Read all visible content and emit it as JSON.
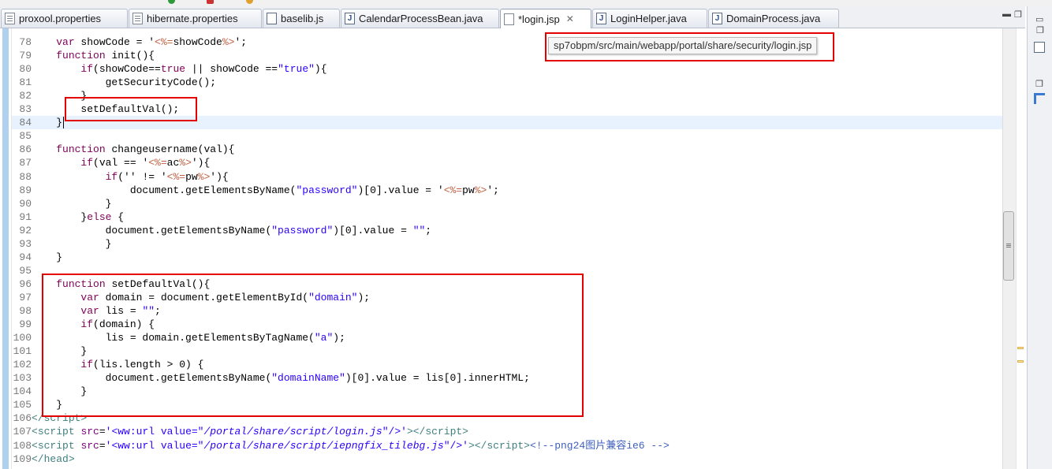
{
  "tabs": [
    {
      "label": "proxool.properties",
      "icon": "properties-file-icon",
      "active": false
    },
    {
      "label": "hibernate.properties",
      "icon": "properties-file-icon",
      "active": false
    },
    {
      "label": "baselib.js",
      "icon": "js-file-icon",
      "active": false
    },
    {
      "label": "CalendarProcessBean.java",
      "icon": "java-file-icon",
      "active": false
    },
    {
      "label": "*login.jsp",
      "icon": "jsp-file-icon",
      "active": true,
      "close": "✕"
    },
    {
      "label": "LoginHelper.java",
      "icon": "java-file-icon",
      "active": false
    },
    {
      "label": "DomainProcess.java",
      "icon": "java-file-icon",
      "active": false
    }
  ],
  "tooltip": "sp7obpm/src/main/webapp/portal/share/security/login.jsp",
  "highlight_color": "#e30000",
  "code": {
    "current_line": "84",
    "lines": [
      {
        "n": "78",
        "segs": [
          [
            "    ",
            ""
          ],
          [
            "var",
            "kw"
          ],
          [
            " showCode = '",
            ""
          ],
          [
            "<%=",
            "jsp"
          ],
          [
            "showCode",
            ""
          ],
          [
            "%>",
            "jsp"
          ],
          [
            "';",
            ""
          ]
        ]
      },
      {
        "n": "79",
        "segs": [
          [
            "    ",
            ""
          ],
          [
            "function",
            "kw"
          ],
          [
            " init(){",
            ""
          ]
        ]
      },
      {
        "n": "80",
        "segs": [
          [
            "        ",
            ""
          ],
          [
            "if",
            "kw"
          ],
          [
            "(showCode==",
            ""
          ],
          [
            "true",
            "kw"
          ],
          [
            " || showCode ==",
            ""
          ],
          [
            "\"true\"",
            "str"
          ],
          [
            "){",
            ""
          ]
        ]
      },
      {
        "n": "81",
        "segs": [
          [
            "            getSecurityCode();",
            ""
          ]
        ]
      },
      {
        "n": "82",
        "segs": [
          [
            "        }",
            ""
          ]
        ]
      },
      {
        "n": "83",
        "segs": [
          [
            "        setDefaultVal();",
            ""
          ]
        ]
      },
      {
        "n": "84",
        "segs": [
          [
            "    }",
            ""
          ]
        ]
      },
      {
        "n": "85",
        "segs": []
      },
      {
        "n": "86",
        "segs": [
          [
            "    ",
            ""
          ],
          [
            "function",
            "kw"
          ],
          [
            " changeusername(val){",
            ""
          ]
        ]
      },
      {
        "n": "87",
        "segs": [
          [
            "        ",
            ""
          ],
          [
            "if",
            "kw"
          ],
          [
            "(val == '",
            ""
          ],
          [
            "<%=",
            "jsp"
          ],
          [
            "ac",
            ""
          ],
          [
            "%>",
            "jsp"
          ],
          [
            "'){",
            ""
          ]
        ]
      },
      {
        "n": "88",
        "segs": [
          [
            "            ",
            ""
          ],
          [
            "if",
            "kw"
          ],
          [
            "('' != '",
            ""
          ],
          [
            "<%=",
            "jsp"
          ],
          [
            "pw",
            ""
          ],
          [
            "%>",
            "jsp"
          ],
          [
            "'){",
            ""
          ]
        ]
      },
      {
        "n": "89",
        "segs": [
          [
            "                document.getElementsByName(",
            ""
          ],
          [
            "\"password\"",
            "str"
          ],
          [
            ")[0].value = '",
            ""
          ],
          [
            "<%=",
            "jsp"
          ],
          [
            "pw",
            ""
          ],
          [
            "%>",
            "jsp"
          ],
          [
            "';",
            ""
          ]
        ]
      },
      {
        "n": "90",
        "segs": [
          [
            "            }",
            ""
          ]
        ]
      },
      {
        "n": "91",
        "segs": [
          [
            "        }",
            ""
          ],
          [
            "else",
            "kw"
          ],
          [
            " {",
            ""
          ]
        ]
      },
      {
        "n": "92",
        "segs": [
          [
            "            document.getElementsByName(",
            ""
          ],
          [
            "\"password\"",
            "str"
          ],
          [
            ")[0].value = ",
            ""
          ],
          [
            "\"\"",
            "str"
          ],
          [
            ";",
            ""
          ]
        ]
      },
      {
        "n": "93",
        "segs": [
          [
            "            }",
            ""
          ]
        ]
      },
      {
        "n": "94",
        "segs": [
          [
            "    }",
            ""
          ]
        ]
      },
      {
        "n": "95",
        "segs": []
      },
      {
        "n": "96",
        "segs": [
          [
            "    ",
            ""
          ],
          [
            "function",
            "kw"
          ],
          [
            " setDefaultVal(){",
            ""
          ]
        ]
      },
      {
        "n": "97",
        "segs": [
          [
            "        ",
            ""
          ],
          [
            "var",
            "kw"
          ],
          [
            " domain = document.getElementById(",
            ""
          ],
          [
            "\"domain\"",
            "str"
          ],
          [
            ");",
            ""
          ]
        ]
      },
      {
        "n": "98",
        "segs": [
          [
            "        ",
            ""
          ],
          [
            "var",
            "kw"
          ],
          [
            " lis = ",
            ""
          ],
          [
            "\"\"",
            "str"
          ],
          [
            ";",
            ""
          ]
        ]
      },
      {
        "n": "99",
        "segs": [
          [
            "        ",
            ""
          ],
          [
            "if",
            "kw"
          ],
          [
            "(domain) {",
            ""
          ]
        ]
      },
      {
        "n": "100",
        "segs": [
          [
            "            lis = domain.getElementsByTagName(",
            ""
          ],
          [
            "\"a\"",
            "str"
          ],
          [
            ");",
            ""
          ]
        ]
      },
      {
        "n": "101",
        "segs": [
          [
            "        }",
            ""
          ]
        ]
      },
      {
        "n": "102",
        "segs": [
          [
            "        ",
            ""
          ],
          [
            "if",
            "kw"
          ],
          [
            "(lis.length > 0) {",
            ""
          ]
        ]
      },
      {
        "n": "103",
        "segs": [
          [
            "            document.getElementsByName(",
            ""
          ],
          [
            "\"domainName\"",
            "str"
          ],
          [
            ")[0].value = lis[0].innerHTML;",
            ""
          ]
        ]
      },
      {
        "n": "104",
        "segs": [
          [
            "        }",
            ""
          ]
        ]
      },
      {
        "n": "105",
        "segs": [
          [
            "    }",
            ""
          ]
        ]
      },
      {
        "n": "106",
        "segs": [
          [
            "</",
            "tag"
          ],
          [
            "script",
            "tag"
          ],
          [
            ">",
            "tag"
          ]
        ]
      },
      {
        "n": "107",
        "segs": [
          [
            "<",
            "tag"
          ],
          [
            "script",
            "tag"
          ],
          [
            " ",
            ""
          ],
          [
            "src",
            "attr"
          ],
          [
            "=",
            ""
          ],
          [
            "'<ww:url value=\"",
            "str"
          ],
          [
            "/portal/share/script/login.js",
            "str ital"
          ],
          [
            "\"/>'",
            "str"
          ],
          [
            "></",
            "tag"
          ],
          [
            "script",
            "tag"
          ],
          [
            ">",
            "tag"
          ]
        ]
      },
      {
        "n": "108",
        "segs": [
          [
            "<",
            "tag"
          ],
          [
            "script",
            "tag"
          ],
          [
            " ",
            ""
          ],
          [
            "src",
            "attr"
          ],
          [
            "=",
            ""
          ],
          [
            "'<ww:url value=\"",
            "str"
          ],
          [
            "/portal/share/script/iepngfix_tilebg.js",
            "str ital"
          ],
          [
            "\"/>'",
            "str"
          ],
          [
            "></",
            "tag"
          ],
          [
            "script",
            "tag"
          ],
          [
            ">",
            "tag"
          ],
          [
            "<!--png24图片兼容ie6 -->",
            "cmt"
          ]
        ]
      },
      {
        "n": "109",
        "segs": [
          [
            "</",
            "tag"
          ],
          [
            "head",
            "tag"
          ],
          [
            ">",
            "tag"
          ]
        ]
      }
    ]
  }
}
